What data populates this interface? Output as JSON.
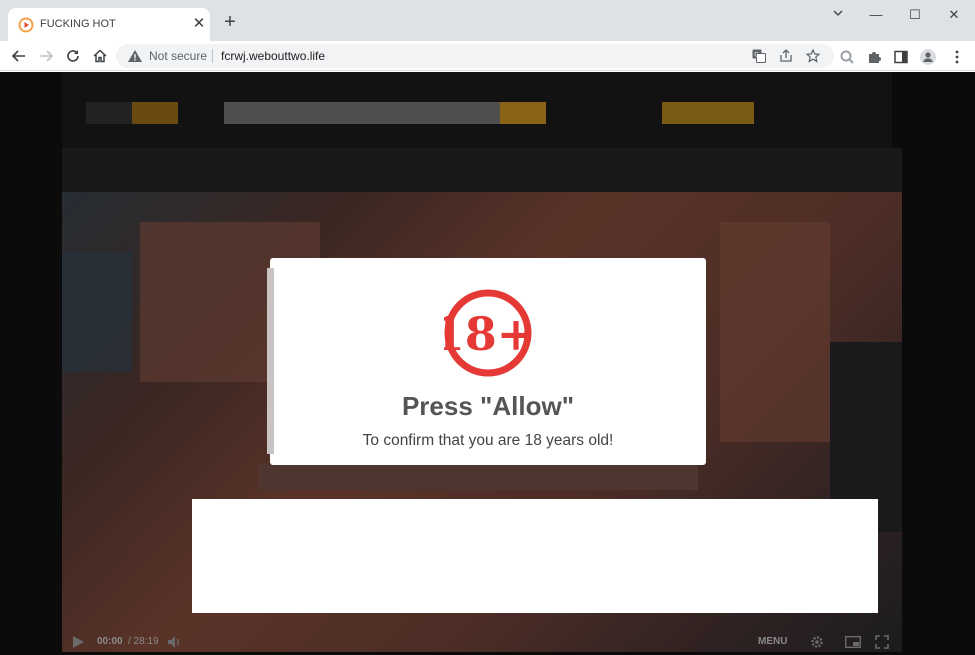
{
  "browser": {
    "tab": {
      "title": "FUCKING HOT",
      "close": "✕"
    },
    "new_tab": "+",
    "window": {
      "minimize": "—",
      "maximize": "☐",
      "close": "✕"
    },
    "security": {
      "label": "Not secure"
    },
    "url": "fcrwj.webouttwo.life"
  },
  "page": {
    "badge_text": "18+",
    "modal": {
      "title": "Press \"Allow\"",
      "subtitle": "To confirm that you are 18 years old!"
    },
    "player": {
      "time": "00:00",
      "duration": "/ 28:19",
      "menu": "MENU"
    }
  },
  "colors": {
    "badge_red": "#e53935",
    "modal_title": "#555555",
    "tabstrip_bg": "#dee1e6"
  }
}
